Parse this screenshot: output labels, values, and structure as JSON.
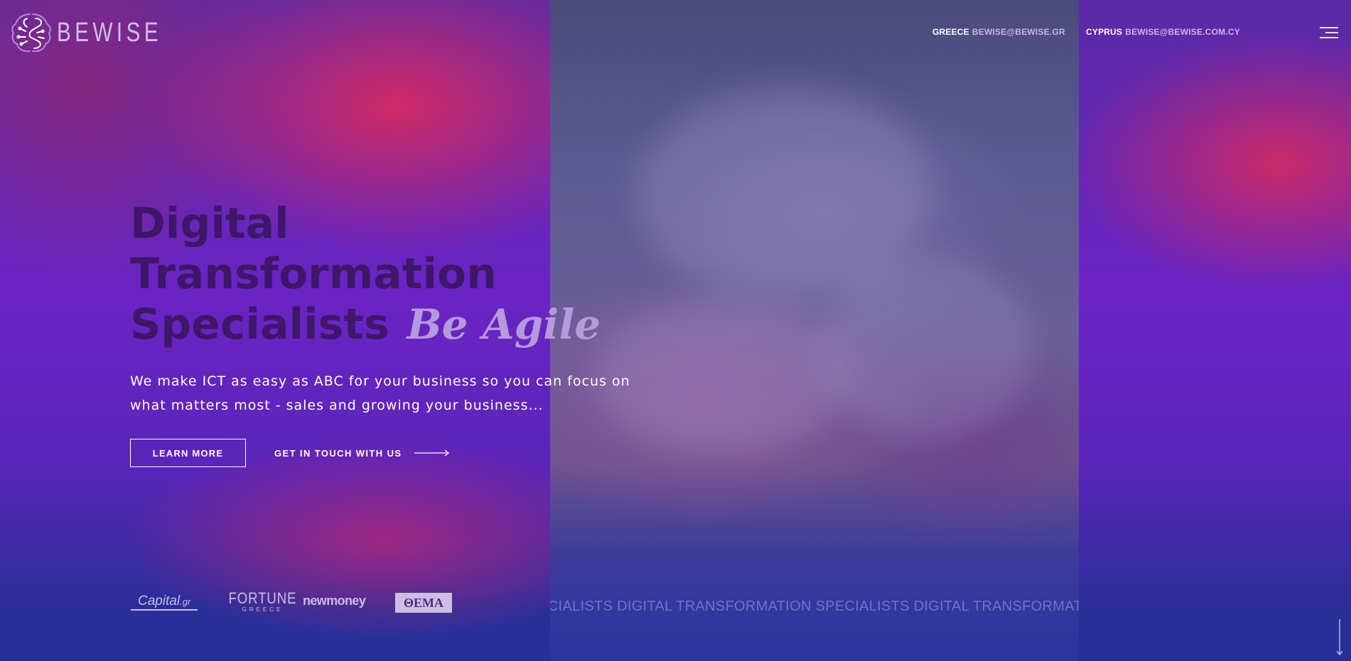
{
  "brand": {
    "name": "BEWISE",
    "logo_icon": "brain-circuit-icon"
  },
  "header": {
    "contacts": [
      {
        "country": "GREECE",
        "email": "BEWISE@BEWISE.GR"
      },
      {
        "country": "CYPRUS",
        "email": "BEWISE@BEWISE.COM.CY"
      }
    ],
    "menu_icon": "hamburger-menu-icon"
  },
  "hero": {
    "headline_line1": "Digital",
    "headline_line2": "Transformation",
    "headline_line3": "Specialists",
    "headline_accent": "Be Agile",
    "subline": "We make ICT as easy as ABC for your business so you can focus on what matters most - sales and growing your business...",
    "primary_button": "LEARN MORE",
    "secondary_link": "GET IN TOUCH WITH US"
  },
  "press": {
    "capital": {
      "main": "Capital",
      "suffix": ".gr"
    },
    "fortune": {
      "main": "FORTUNE",
      "sub": "GREECE"
    },
    "newmoney": "newmoney",
    "thema": "ΘΕΜΑ"
  },
  "marquee": "SPECIALISTS DIGITAL TRANSFORMATION SPECIALISTS DIGITAL TRANSFORMATION",
  "colors": {
    "headline": "#3e1769",
    "accent": "#b59add",
    "pink": "#d62a62",
    "purple": "#6a24c4",
    "blue": "#26309a"
  },
  "scroll_icon": "arrow-down-icon"
}
